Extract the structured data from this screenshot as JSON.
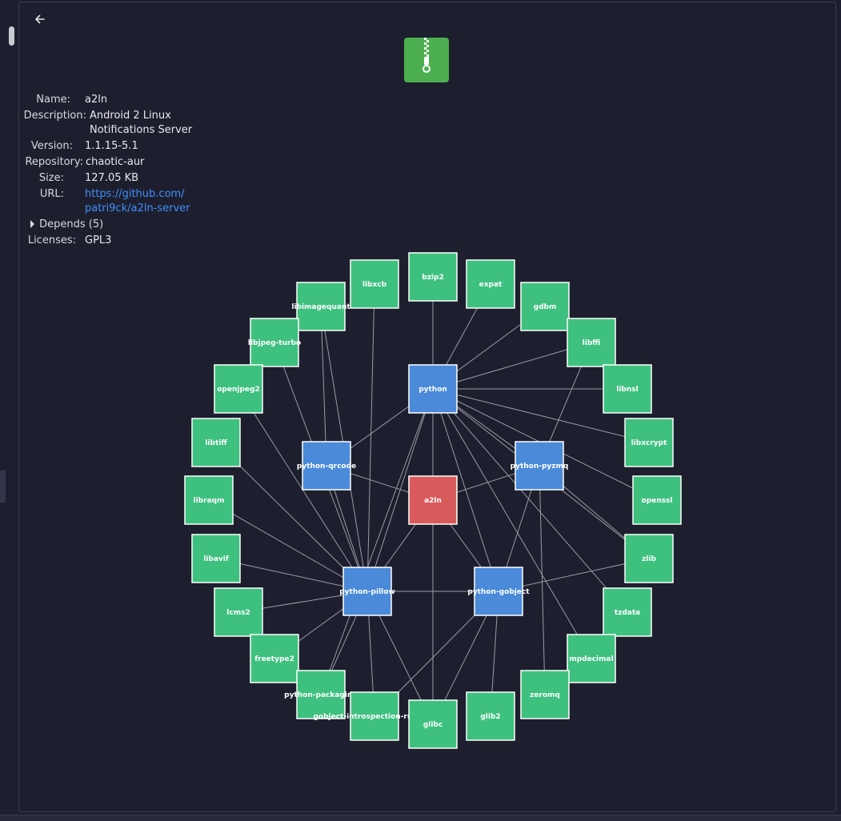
{
  "back": {
    "icon": "back-arrow-icon"
  },
  "package_icon": {
    "icon": "archive-zip-icon",
    "color": "#4caf50"
  },
  "details": {
    "name_label": "Name:",
    "name_value": "a2ln",
    "description_label": "Description:",
    "description_line1": "Android 2 Linux",
    "description_line2": "Notifications Server",
    "version_label": "Version:",
    "version_value": "1.1.15-5.1",
    "repository_label": "Repository:",
    "repository_value": "chaotic-aur",
    "size_label": "Size:",
    "size_value": "127.05 KB",
    "url_label": "URL:",
    "url_line1": "https://github.com/",
    "url_line2": "patri9ck/a2ln-server",
    "depends_label": "Depends (5)",
    "licenses_label": "Licenses:",
    "licenses_value": "GPL3"
  },
  "colors": {
    "root": "#d95a5a",
    "direct_dependency": "#4a8ad8",
    "transitive_dependency": "#3ec07f",
    "edge": "#9a9ba6"
  },
  "graph": {
    "root": "a2ln",
    "direct": [
      "python",
      "python-qrcode",
      "python-pyzmq",
      "python-pillow",
      "python-gobject"
    ],
    "leaves": [
      "libxcb",
      "bzip2",
      "expat",
      "gdbm",
      "libimagequant",
      "libjpeg-turbo",
      "libffi",
      "openjpeg2",
      "libnsl",
      "libtiff",
      "libxcrypt",
      "libraqm",
      "openssl",
      "libavif",
      "zlib",
      "lcms2",
      "tzdata",
      "freetype2",
      "mpdecimal",
      "zeromq",
      "python-packaging",
      "gobject-introspection-runtime",
      "glibc",
      "glib2"
    ]
  }
}
